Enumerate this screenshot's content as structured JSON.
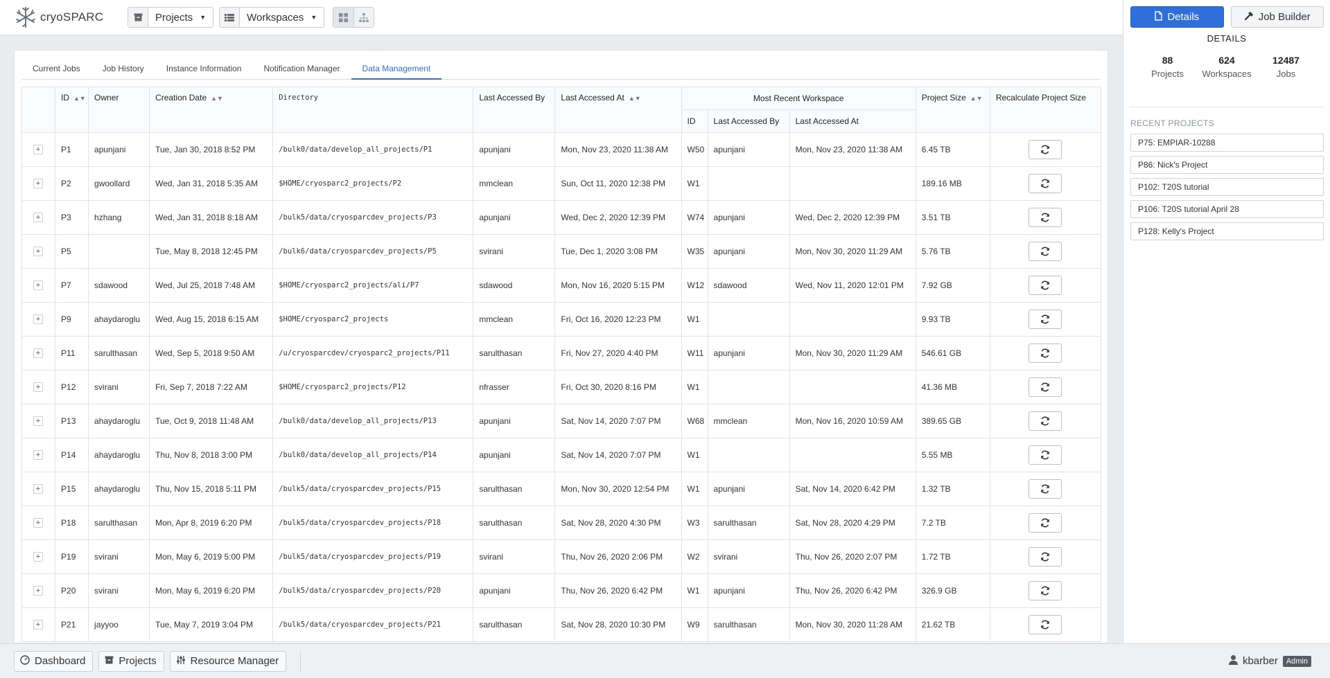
{
  "app": {
    "name": "cryoSPARC",
    "projects_label": "Projects",
    "workspaces_label": "Workspaces"
  },
  "tabs": [
    "Current Jobs",
    "Job History",
    "Instance Information",
    "Notification Manager",
    "Data Management"
  ],
  "active_tab": "Data Management",
  "table": {
    "headers": {
      "id": "ID",
      "owner": "Owner",
      "creation_date": "Creation Date",
      "directory": "Directory",
      "last_accessed_by": "Last Accessed By",
      "last_accessed_at": "Last Accessed At",
      "most_recent_workspace": "Most Recent Workspace",
      "ws_id": "ID",
      "ws_last_accessed_by": "Last Accessed By",
      "ws_last_accessed_at": "Last Accessed At",
      "project_size": "Project Size",
      "recalculate": "Recalculate Project Size"
    },
    "rows": [
      {
        "id": "P1",
        "owner": "apunjani",
        "created": "Tue, Jan 30, 2018 8:52 PM",
        "dir": "/bulk0/data/develop_all_projects/P1",
        "by": "apunjani",
        "at": "Mon, Nov 23, 2020 11:38 AM",
        "ws": "W50",
        "ws_by": "apunjani",
        "ws_at": "Mon, Nov 23, 2020 11:38 AM",
        "size": "6.45 TB"
      },
      {
        "id": "P2",
        "owner": "gwoollard",
        "created": "Wed, Jan 31, 2018 5:35 AM",
        "dir": "$HOME/cryosparc2_projects/P2",
        "by": "mmclean",
        "at": "Sun, Oct 11, 2020 12:38 PM",
        "ws": "W1",
        "ws_by": "",
        "ws_at": "",
        "size": "189.16 MB"
      },
      {
        "id": "P3",
        "owner": "hzhang",
        "created": "Wed, Jan 31, 2018 8:18 AM",
        "dir": "/bulk5/data/cryosparcdev_projects/P3",
        "by": "apunjani",
        "at": "Wed, Dec 2, 2020 12:39 PM",
        "ws": "W74",
        "ws_by": "apunjani",
        "ws_at": "Wed, Dec 2, 2020 12:39 PM",
        "size": "3.51 TB"
      },
      {
        "id": "P5",
        "owner": "",
        "created": "Tue, May 8, 2018 12:45 PM",
        "dir": "/bulk6/data/cryosparcdev_projects/P5",
        "by": "svirani",
        "at": "Tue, Dec 1, 2020 3:08 PM",
        "ws": "W35",
        "ws_by": "apunjani",
        "ws_at": "Mon, Nov 30, 2020 11:29 AM",
        "size": "5.76 TB"
      },
      {
        "id": "P7",
        "owner": "sdawood",
        "created": "Wed, Jul 25, 2018 7:48 AM",
        "dir": "$HOME/cryosparc2_projects/ali/P7",
        "by": "sdawood",
        "at": "Mon, Nov 16, 2020 5:15 PM",
        "ws": "W12",
        "ws_by": "sdawood",
        "ws_at": "Wed, Nov 11, 2020 12:01 PM",
        "size": "7.92 GB"
      },
      {
        "id": "P9",
        "owner": "ahaydaroglu",
        "created": "Wed, Aug 15, 2018 6:15 AM",
        "dir": "$HOME/cryosparc2_projects",
        "by": "mmclean",
        "at": "Fri, Oct 16, 2020 12:23 PM",
        "ws": "W1",
        "ws_by": "",
        "ws_at": "",
        "size": "9.93 TB"
      },
      {
        "id": "P11",
        "owner": "sarulthasan",
        "created": "Wed, Sep 5, 2018 9:50 AM",
        "dir": "/u/cryosparcdev/cryosparc2_projects/P11",
        "by": "sarulthasan",
        "at": "Fri, Nov 27, 2020 4:40 PM",
        "ws": "W11",
        "ws_by": "apunjani",
        "ws_at": "Mon, Nov 30, 2020 11:29 AM",
        "size": "546.61 GB"
      },
      {
        "id": "P12",
        "owner": "svirani",
        "created": "Fri, Sep 7, 2018 7:22 AM",
        "dir": "$HOME/cryosparc2_projects/P12",
        "by": "nfrasser",
        "at": "Fri, Oct 30, 2020 8:16 PM",
        "ws": "W1",
        "ws_by": "",
        "ws_at": "",
        "size": "41.36 MB"
      },
      {
        "id": "P13",
        "owner": "ahaydaroglu",
        "created": "Tue, Oct 9, 2018 11:48 AM",
        "dir": "/bulk0/data/develop_all_projects/P13",
        "by": "apunjani",
        "at": "Sat, Nov 14, 2020 7:07 PM",
        "ws": "W68",
        "ws_by": "mmclean",
        "ws_at": "Mon, Nov 16, 2020 10:59 AM",
        "size": "389.65 GB"
      },
      {
        "id": "P14",
        "owner": "ahaydaroglu",
        "created": "Thu, Nov 8, 2018 3:00 PM",
        "dir": "/bulk0/data/develop_all_projects/P14",
        "by": "apunjani",
        "at": "Sat, Nov 14, 2020 7:07 PM",
        "ws": "W1",
        "ws_by": "",
        "ws_at": "",
        "size": "5.55 MB"
      },
      {
        "id": "P15",
        "owner": "ahaydaroglu",
        "created": "Thu, Nov 15, 2018 5:11 PM",
        "dir": "/bulk5/data/cryosparcdev_projects/P15",
        "by": "sarulthasan",
        "at": "Mon, Nov 30, 2020 12:54 PM",
        "ws": "W1",
        "ws_by": "apunjani",
        "ws_at": "Sat, Nov 14, 2020 6:42 PM",
        "size": "1.32 TB"
      },
      {
        "id": "P18",
        "owner": "sarulthasan",
        "created": "Mon, Apr 8, 2019 6:20 PM",
        "dir": "/bulk5/data/cryosparcdev_projects/P18",
        "by": "sarulthasan",
        "at": "Sat, Nov 28, 2020 4:30 PM",
        "ws": "W3",
        "ws_by": "sarulthasan",
        "ws_at": "Sat, Nov 28, 2020 4:29 PM",
        "size": "7.2 TB"
      },
      {
        "id": "P19",
        "owner": "svirani",
        "created": "Mon, May 6, 2019 5:00 PM",
        "dir": "/bulk5/data/cryosparcdev_projects/P19",
        "by": "svirani",
        "at": "Thu, Nov 26, 2020 2:06 PM",
        "ws": "W2",
        "ws_by": "svirani",
        "ws_at": "Thu, Nov 26, 2020 2:07 PM",
        "size": "1.72 TB"
      },
      {
        "id": "P20",
        "owner": "svirani",
        "created": "Mon, May 6, 2019 6:20 PM",
        "dir": "/bulk5/data/cryosparcdev_projects/P20",
        "by": "apunjani",
        "at": "Thu, Nov 26, 2020 6:42 PM",
        "ws": "W1",
        "ws_by": "apunjani",
        "ws_at": "Thu, Nov 26, 2020 6:42 PM",
        "size": "326.9 GB"
      },
      {
        "id": "P21",
        "owner": "jayyoo",
        "created": "Tue, May 7, 2019 3:04 PM",
        "dir": "/bulk5/data/cryosparcdev_projects/P21",
        "by": "sarulthasan",
        "at": "Sat, Nov 28, 2020 10:30 PM",
        "ws": "W9",
        "ws_by": "sarulthasan",
        "ws_at": "Mon, Nov 30, 2020 11:28 AM",
        "size": "21.62 TB"
      }
    ]
  },
  "right_panel": {
    "details_button": "Details",
    "job_builder_button": "Job Builder",
    "title": "DETAILS",
    "stats": [
      {
        "value": "88",
        "label": "Projects"
      },
      {
        "value": "624",
        "label": "Workspaces"
      },
      {
        "value": "12487",
        "label": "Jobs"
      }
    ],
    "recent_title": "RECENT PROJECTS",
    "recent_projects": [
      "P75: EMPIAR-10288",
      "P86: Nick's Project",
      "P102: T20S tutorial",
      "P106: T20S tutorial April 28",
      "P128: Kelly's Project"
    ]
  },
  "bottom_bar": {
    "dashboard": "Dashboard",
    "projects": "Projects",
    "resource_manager": "Resource Manager",
    "username": "kbarber",
    "role": "Admin"
  },
  "colors": {
    "accent": "#2f6fdb",
    "badge": "#555c63"
  }
}
